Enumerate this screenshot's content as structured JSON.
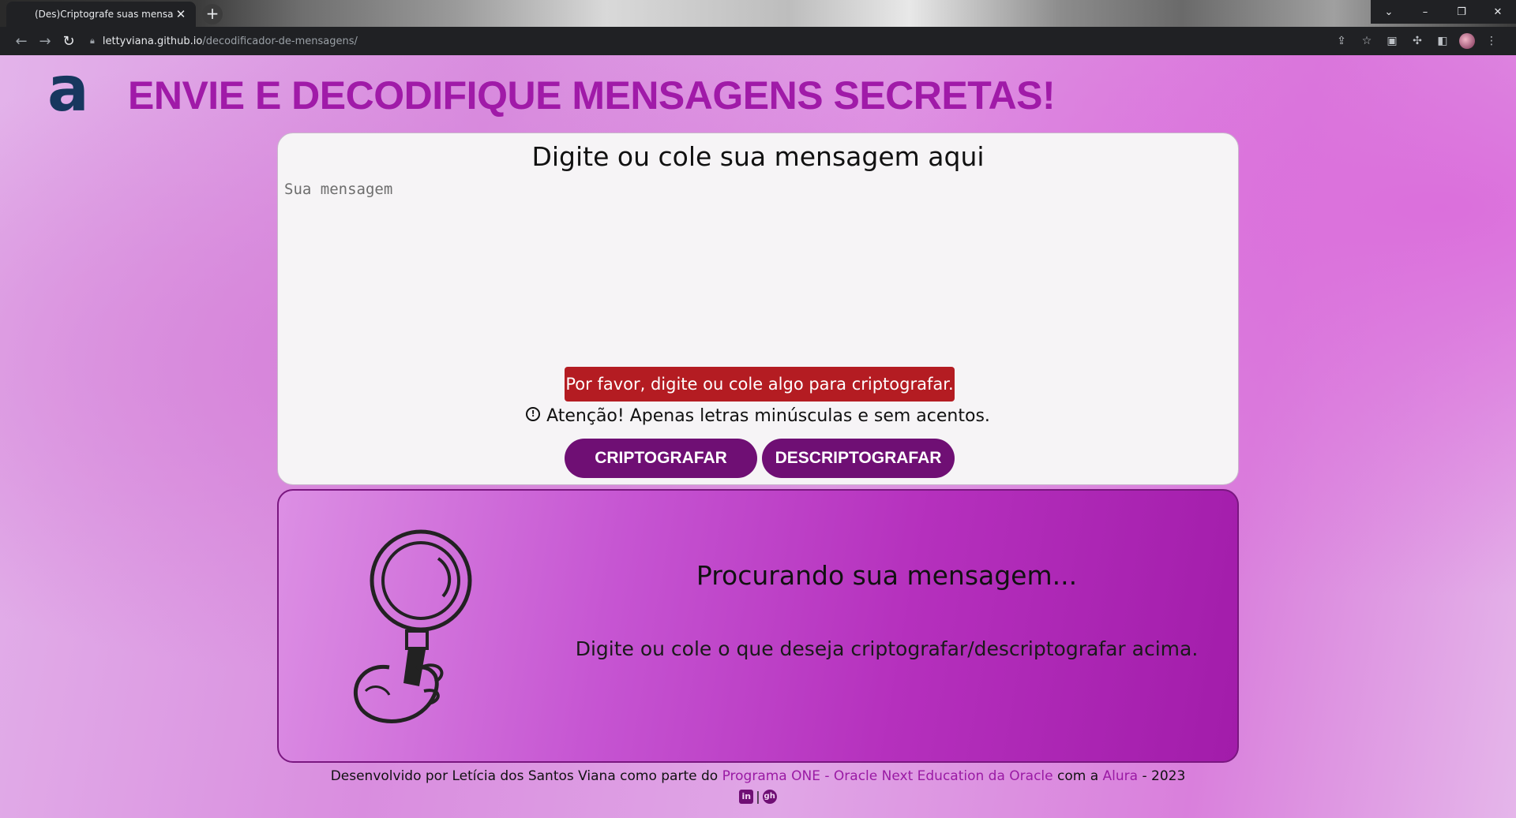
{
  "browser": {
    "tab_title": "(Des)Criptografe suas mensagen",
    "tab_close": "✕",
    "new_tab": "+",
    "url_host": "lettyviana.github.io",
    "url_path": "/decodificador-de-mensagens/",
    "controls": {
      "tabs_menu": "⌄",
      "minimize": "–",
      "restore": "❐",
      "close": "✕"
    }
  },
  "header": {
    "logo": "a",
    "title": "ENVIE E DECODIFIQUE MENSAGENS SECRETAS!"
  },
  "input_card": {
    "heading": "Digite ou cole sua mensagem aqui",
    "placeholder": "Sua mensagem",
    "error": "Por favor, digite ou cole algo para criptografar.",
    "warning_icon": "!",
    "warning": "Atenção! Apenas letras minúsculas e sem acentos.",
    "encrypt_label": "CRIPTOGRAFAR",
    "decrypt_label": "DESCRIPTOGRAFAR"
  },
  "output_card": {
    "title": "Procurando sua mensagem...",
    "text": "Digite ou cole o que deseja criptografar/descriptografar acima."
  },
  "footer": {
    "prefix": "Desenvolvido por Letícia dos Santos Viana como parte do ",
    "program_link": "Programa ONE - Oracle Next Education da Oracle",
    "middle": " com a ",
    "alura_link": "Alura",
    "suffix": " - 2023",
    "linkedin": "in",
    "separator": "|",
    "github": "gh"
  },
  "colors": {
    "title": "#a01aa8",
    "button": "#6f0f74",
    "error": "#b41c22",
    "logo": "#17375e"
  }
}
